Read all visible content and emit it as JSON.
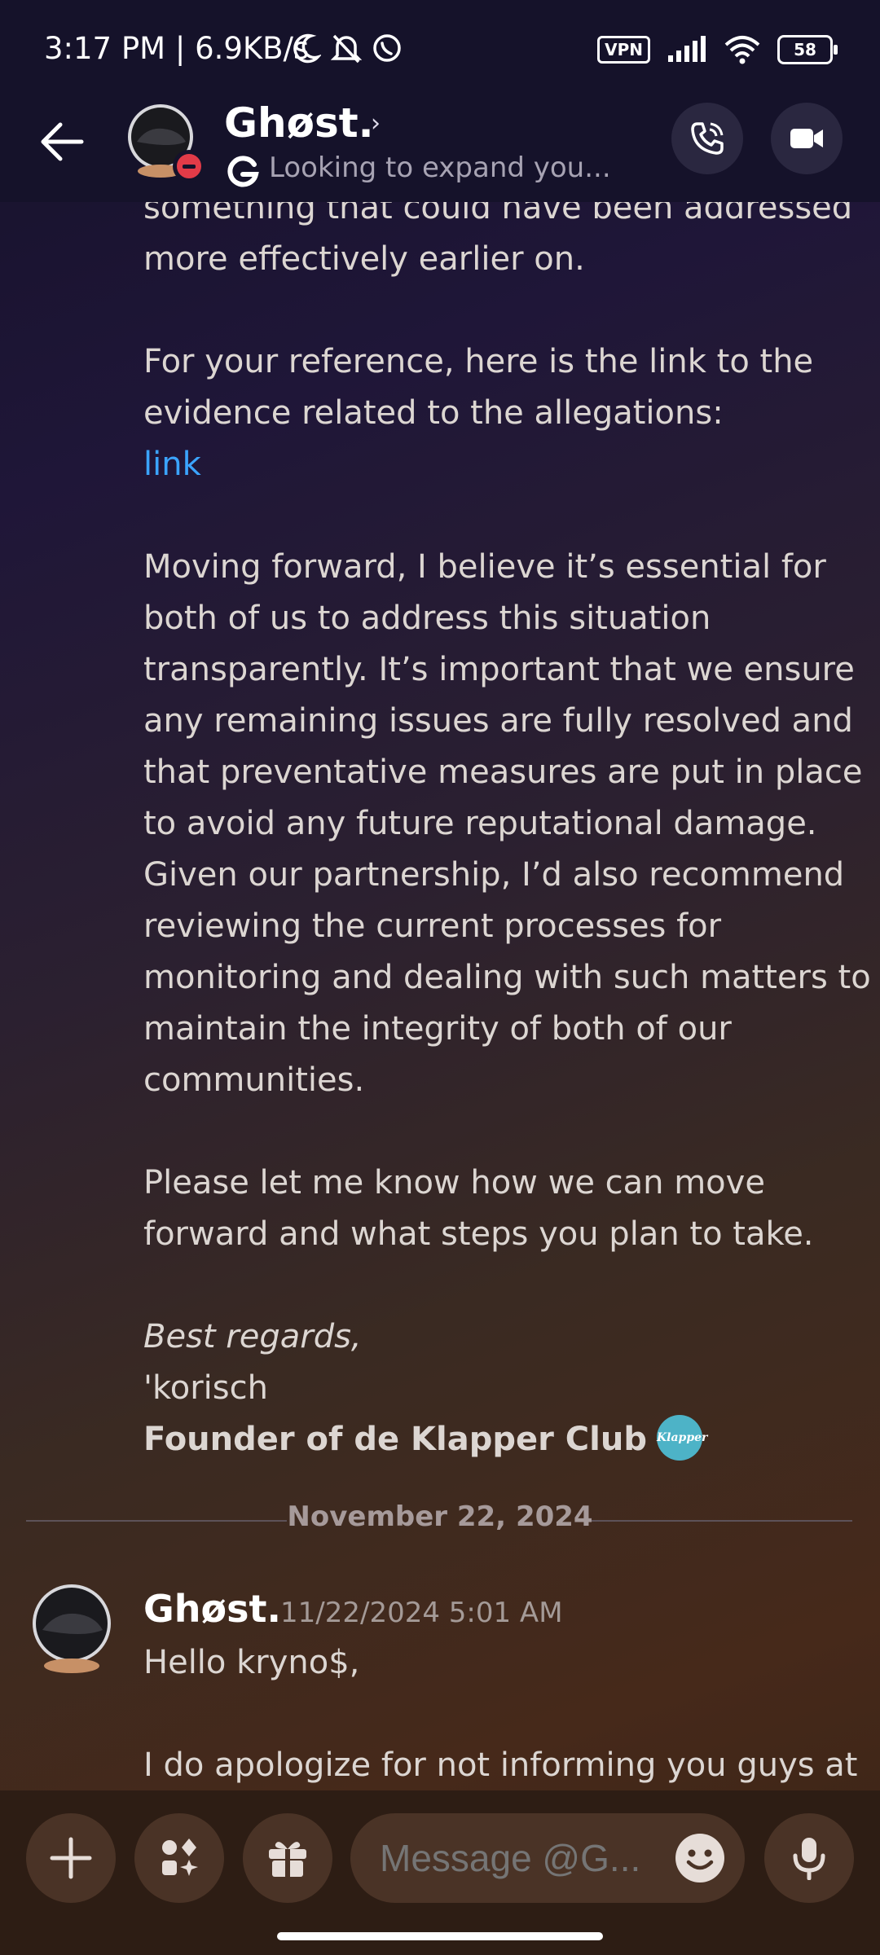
{
  "status_bar": {
    "time": "3:17 PM | 6.9KB/s",
    "vpn": "VPN",
    "battery": "58"
  },
  "header": {
    "name": "Ghøst.",
    "chevron": "›",
    "status": "Looking to expand you..."
  },
  "message": {
    "lines_top": [
      "something that could have been addressed",
      "more effectively earlier on."
    ],
    "reference_lines": [
      "For your reference, here is the link to the",
      "evidence related to the allegations:"
    ],
    "link_text": "link",
    "paragraph": [
      "Moving forward, I believe it’s essential for",
      "both of us to address this situation",
      "transparently. It’s important that we ensure",
      "any remaining issues are fully resolved and",
      "that preventative measures are put in place",
      "to avoid any future reputational damage.",
      "Given our partnership, I’d also recommend",
      "reviewing the current processes for",
      "monitoring and dealing with such matters to",
      "maintain the integrity of both of our",
      "communities."
    ],
    "closing": [
      "Please let me know how we can move",
      "forward and what steps you plan to take."
    ],
    "regards": "Best regards,",
    "signature": "'korisch",
    "title": "Founder of de Klapper Club",
    "badge_text": "Klapper"
  },
  "divider": {
    "date": "November 22, 2024"
  },
  "next_message": {
    "author": "Ghøst.",
    "timestamp": "11/22/2024 5:01 AM",
    "greeting": "Hello kryno$,",
    "preview": "I do apologize for not informing you guys at"
  },
  "composer": {
    "placeholder": "Message @G..."
  },
  "icons": {
    "back": "back-arrow-icon",
    "call": "phone-call-icon",
    "video": "video-camera-icon",
    "add": "plus-icon",
    "apps": "apps-icon",
    "gift": "gift-icon",
    "emoji": "emoji-icon",
    "mic": "microphone-icon"
  },
  "colors": {
    "link": "#3ba4ff",
    "dnd": "#e23b48"
  }
}
